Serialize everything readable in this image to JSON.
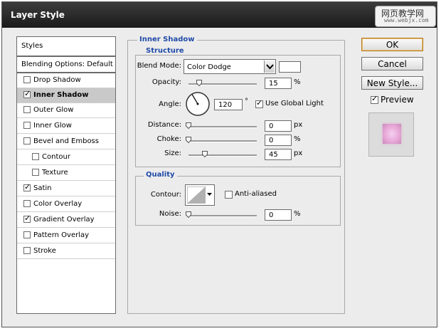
{
  "window": {
    "title": "Layer Style"
  },
  "watermark": {
    "line1": "网页教学网",
    "line2": "www.webjx.com"
  },
  "sidebar": {
    "items": [
      {
        "label": "Styles"
      },
      {
        "label": "Blending Options: Default"
      },
      {
        "label": "Drop Shadow",
        "checked": false
      },
      {
        "label": "Inner Shadow",
        "checked": true,
        "selected": true
      },
      {
        "label": "Outer Glow",
        "checked": false
      },
      {
        "label": "Inner Glow",
        "checked": false
      },
      {
        "label": "Bevel and Emboss",
        "checked": false
      },
      {
        "label": "Contour",
        "checked": false
      },
      {
        "label": "Texture",
        "checked": false
      },
      {
        "label": "Satin",
        "checked": true
      },
      {
        "label": "Color Overlay",
        "checked": false
      },
      {
        "label": "Gradient Overlay",
        "checked": true
      },
      {
        "label": "Pattern Overlay",
        "checked": false
      },
      {
        "label": "Stroke",
        "checked": false
      }
    ]
  },
  "inner_shadow": {
    "title": "Inner Shadow",
    "structure": {
      "title": "Structure",
      "blend_mode_label": "Blend Mode:",
      "blend_mode_value": "Color Dodge",
      "shadow_color": "#ffffff",
      "opacity_label": "Opacity:",
      "opacity_value": "15",
      "opacity_unit": "%",
      "opacity_fraction": 0.15,
      "angle_label": "Angle:",
      "angle_value": "120",
      "angle_unit": "°",
      "angle_degrees": 120,
      "use_global_light_label": "Use Global Light",
      "use_global_light_checked": true,
      "distance_label": "Distance:",
      "distance_value": "0",
      "distance_unit": "px",
      "choke_label": "Choke:",
      "choke_value": "0",
      "choke_unit": "%",
      "size_label": "Size:",
      "size_value": "45",
      "size_unit": "px",
      "size_fraction": 0.18
    },
    "quality": {
      "title": "Quality",
      "contour_label": "Contour:",
      "anti_aliased_label": "Anti-aliased",
      "anti_aliased_checked": false,
      "noise_label": "Noise:",
      "noise_value": "0",
      "noise_unit": "%"
    }
  },
  "buttons": {
    "ok": "OK",
    "cancel": "Cancel",
    "new_style": "New Style...",
    "preview_label": "Preview",
    "preview_checked": true
  },
  "colors": {
    "title_text": "#ffffff",
    "group_title": "#1f4aa8",
    "preview_swatch": "#e8a8d8"
  }
}
